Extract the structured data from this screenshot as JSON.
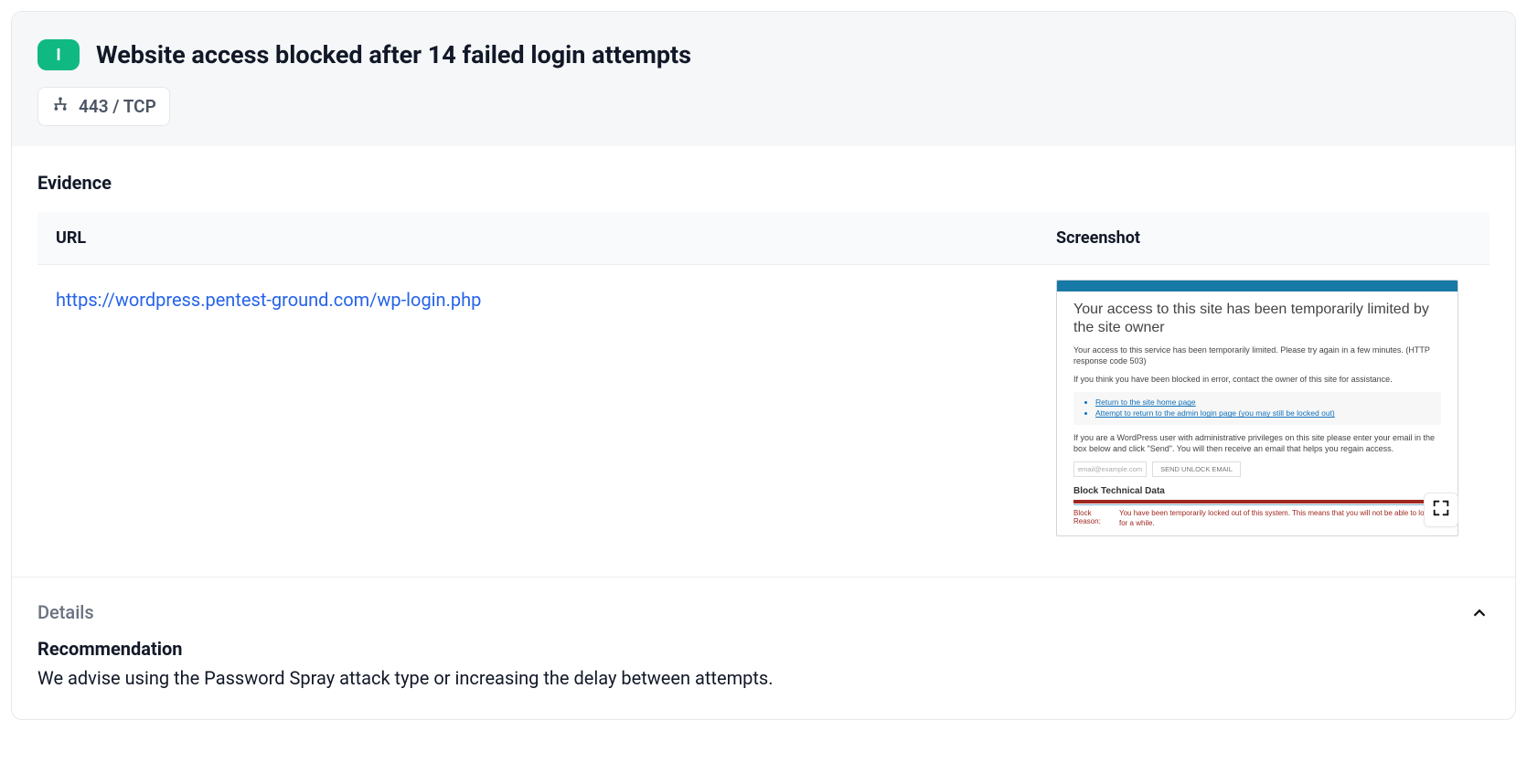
{
  "header": {
    "severity_label": "I",
    "title": "Website access blocked after 14 failed login attempts",
    "port_label": "443 / TCP"
  },
  "evidence": {
    "section_title": "Evidence",
    "columns": {
      "url": "URL",
      "screenshot": "Screenshot"
    },
    "rows": [
      {
        "url": "https://wordpress.pentest-ground.com/wp-login.php",
        "screenshot": {
          "heading": "Your access to this site has been temporarily limited by the site owner",
          "para1": "Your access to this service has been temporarily limited. Please try again in a few minutes. (HTTP response code 503)",
          "para2": "If you think you have been blocked in error, contact the owner of this site for assistance.",
          "links": [
            "Return to the site home page",
            "Attempt to return to the admin login page (you may still be locked out)"
          ],
          "para3": "If you are a WordPress user with administrative privileges on this site please enter your email in the box below and click \"Send\". You will then receive an email that helps you regain access.",
          "email_placeholder": "email@example.com",
          "send_button": "SEND UNLOCK EMAIL",
          "tech_heading": "Block Technical Data",
          "reason_label": "Block Reason:",
          "reason_text": "You have been temporarily locked out of this system. This means that you will not be able to log in for a while."
        }
      }
    ]
  },
  "details": {
    "section_label": "Details",
    "recommendation_title": "Recommendation",
    "recommendation_text": "We advise using the Password Spray attack type or increasing the delay between attempts."
  }
}
